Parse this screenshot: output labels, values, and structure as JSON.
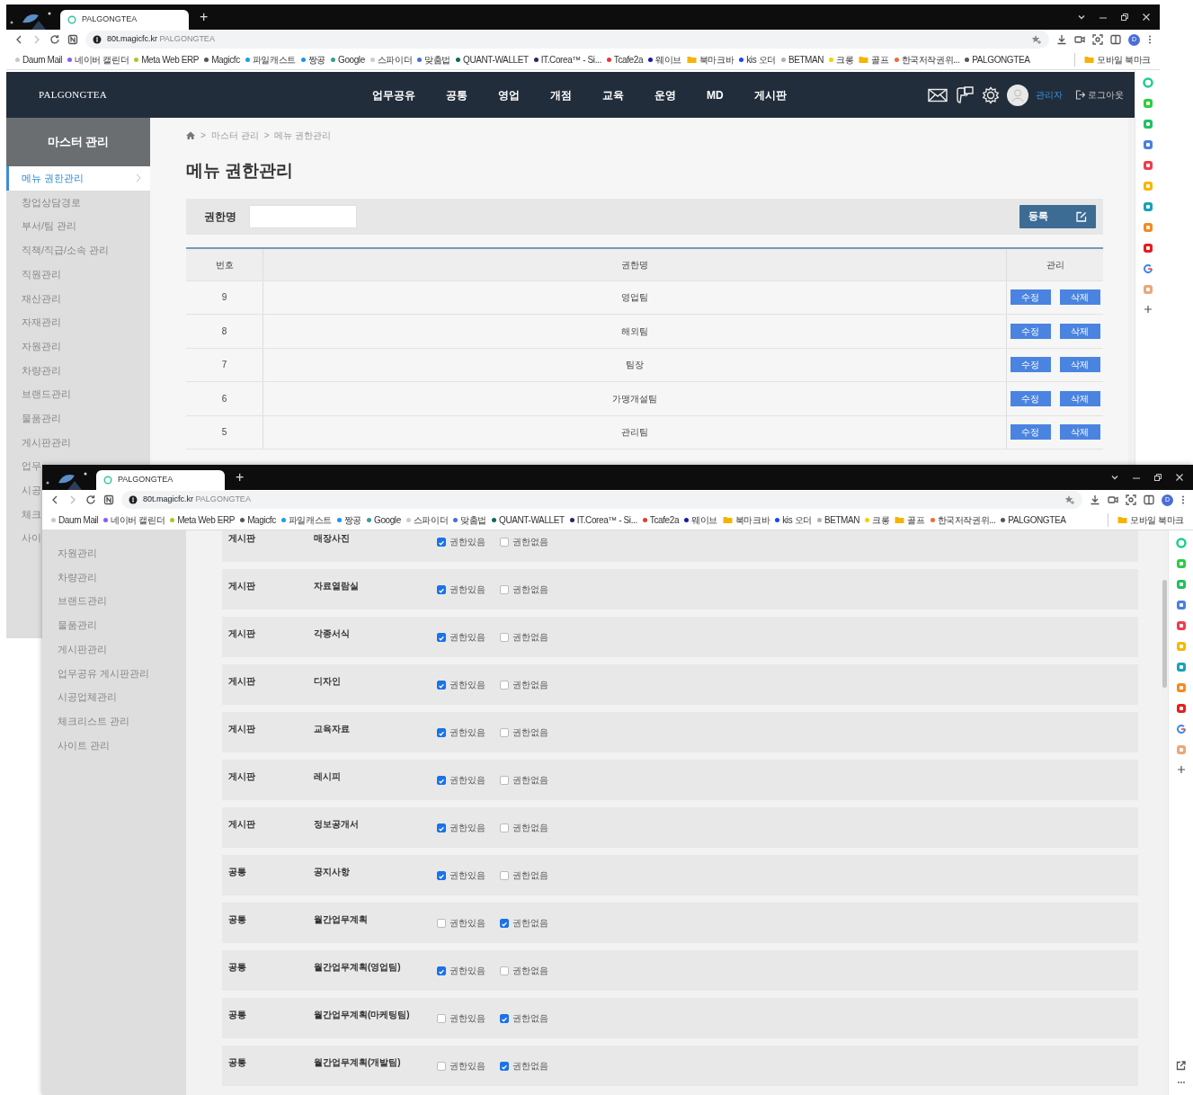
{
  "windows": [
    {
      "browser": {
        "tab_title": "PALGONGTEA",
        "new_tab": "+",
        "url_host": "80t.magicfc.kr",
        "url_title": "PALGONGTEA",
        "profile": "D",
        "mobile_bookmarks": "모바일 북마크",
        "bookmarks": [
          {
            "label": "Daum Mail",
            "kind": "site",
            "color": "#c8c8c8"
          },
          {
            "label": "네이버 캘린더",
            "kind": "site",
            "color": "#8a5cf6"
          },
          {
            "label": "Meta Web ERP",
            "kind": "site",
            "color": "#b5c22a"
          },
          {
            "label": "Magicfc",
            "kind": "site",
            "color": "#555555"
          },
          {
            "label": "파일캐스트",
            "kind": "site",
            "color": "#1ba1e2"
          },
          {
            "label": "짱공",
            "kind": "site",
            "color": "#1e90ff"
          },
          {
            "label": "Google",
            "kind": "site",
            "color": "#3a9e8f"
          },
          {
            "label": "스파이더",
            "kind": "site",
            "color": "#cccccc"
          },
          {
            "label": "맞춤법",
            "kind": "site",
            "color": "#4a6ed8"
          },
          {
            "label": "QUANT-WALLET",
            "kind": "site",
            "color": "#0b6b5a"
          },
          {
            "label": "IT.Corea™ - Si...",
            "kind": "site",
            "color": "#28285e"
          },
          {
            "label": "Tcafe2a",
            "kind": "site",
            "color": "#e53935"
          },
          {
            "label": "웨이브",
            "kind": "site",
            "color": "#1a1aa0"
          },
          {
            "label": "북마크바",
            "kind": "folder"
          },
          {
            "label": "kis 오더",
            "kind": "site",
            "color": "#1546ff"
          },
          {
            "label": "BETMAN",
            "kind": "site",
            "color": "#b0b0b0"
          },
          {
            "label": "크롱",
            "kind": "site",
            "color": "#ffcc00"
          },
          {
            "label": "골프",
            "kind": "folder"
          },
          {
            "label": "한국저작권위...",
            "kind": "site",
            "color": "#f06a3c"
          },
          {
            "label": "PALGONGTEA",
            "kind": "site",
            "color": "#555555"
          }
        ]
      },
      "app": {
        "logo": "PALGONGTEA",
        "nav": [
          "업무공유",
          "공통",
          "영업",
          "개점",
          "교육",
          "운영",
          "MD",
          "게시판"
        ],
        "user": "관리자",
        "logout": "로그아웃",
        "sidebar": {
          "title": "마스터 관리",
          "items": [
            {
              "label": "메뉴 권한관리",
              "selected": true
            },
            {
              "label": "창업상담경로",
              "selected": false
            },
            {
              "label": "부서/팀 관리",
              "selected": false
            },
            {
              "label": "직책/직급/소속 관리",
              "selected": false
            },
            {
              "label": "직원관리",
              "selected": false
            },
            {
              "label": "재산관리",
              "selected": false
            },
            {
              "label": "자재관리",
              "selected": false
            },
            {
              "label": "자원관리",
              "selected": false
            },
            {
              "label": "차량관리",
              "selected": false
            },
            {
              "label": "브랜드관리",
              "selected": false
            },
            {
              "label": "물품관리",
              "selected": false
            },
            {
              "label": "게시판관리",
              "selected": false
            },
            {
              "label": "업무",
              "selected": false
            },
            {
              "label": "시공",
              "selected": false
            },
            {
              "label": "체크",
              "selected": false
            },
            {
              "label": "사이",
              "selected": false
            }
          ]
        },
        "breadcrumb": [
          {
            "separator": ">",
            "label": "마스터 관리"
          },
          {
            "separator": ">",
            "label": "메뉴 권한관리"
          }
        ],
        "page_title": "메뉴 권한관리",
        "search": {
          "label": "권한명"
        },
        "register_button": "등록",
        "table": {
          "columns": [
            "번호",
            "권한명",
            "관리"
          ],
          "rows": [
            {
              "number": "9",
              "name": "영업팀",
              "edit": "수정",
              "delete": "삭제"
            },
            {
              "number": "8",
              "name": "해외팀",
              "edit": "수정",
              "delete": "삭제"
            },
            {
              "number": "7",
              "name": "팀장",
              "edit": "수정",
              "delete": "삭제"
            },
            {
              "number": "6",
              "name": "가맹개설팀",
              "edit": "수정",
              "delete": "삭제"
            },
            {
              "number": "5",
              "name": "관리팀",
              "edit": "수정",
              "delete": "삭제"
            }
          ]
        }
      }
    },
    {
      "browser": {
        "tab_title": "PALGONGTEA",
        "new_tab": "+",
        "url_host": "80t.magicfc.kr",
        "url_title": "PALGONGTEA",
        "profile": "D",
        "mobile_bookmarks": "모바일 북마크",
        "bookmarks": [
          {
            "label": "Daum Mail",
            "kind": "site",
            "color": "#c8c8c8"
          },
          {
            "label": "네이버 캘린더",
            "kind": "site",
            "color": "#8a5cf6"
          },
          {
            "label": "Meta Web ERP",
            "kind": "site",
            "color": "#b5c22a"
          },
          {
            "label": "Magicfc",
            "kind": "site",
            "color": "#555555"
          },
          {
            "label": "파일캐스트",
            "kind": "site",
            "color": "#1ba1e2"
          },
          {
            "label": "짱공",
            "kind": "site",
            "color": "#1e90ff"
          },
          {
            "label": "Google",
            "kind": "site",
            "color": "#3a9e8f"
          },
          {
            "label": "스파이더",
            "kind": "site",
            "color": "#cccccc"
          },
          {
            "label": "맞춤법",
            "kind": "site",
            "color": "#4a6ed8"
          },
          {
            "label": "QUANT-WALLET",
            "kind": "site",
            "color": "#0b6b5a"
          },
          {
            "label": "IT.Corea™ - Si...",
            "kind": "site",
            "color": "#28285e"
          },
          {
            "label": "Tcafe2a",
            "kind": "site",
            "color": "#e53935"
          },
          {
            "label": "웨이브",
            "kind": "site",
            "color": "#1a1aa0"
          },
          {
            "label": "북마크바",
            "kind": "folder"
          },
          {
            "label": "kis 오더",
            "kind": "site",
            "color": "#1546ff"
          },
          {
            "label": "BETMAN",
            "kind": "site",
            "color": "#b0b0b0"
          },
          {
            "label": "크롱",
            "kind": "site",
            "color": "#ffcc00"
          },
          {
            "label": "골프",
            "kind": "folder"
          },
          {
            "label": "한국저작권위...",
            "kind": "site",
            "color": "#f06a3c"
          },
          {
            "label": "PALGONGTEA",
            "kind": "site",
            "color": "#555555"
          }
        ]
      },
      "sidebar_items": [
        "자원관리",
        "차량관리",
        "브랜드관리",
        "물품관리",
        "게시판관리",
        "업무공유 게시판관리",
        "시공업체관리",
        "체크리스트 관리",
        "사이트 관리"
      ],
      "permissions": [
        {
          "category": "게시판",
          "menu": "매장사진",
          "options": [
            {
              "label": "권한있음",
              "checked": true
            },
            {
              "label": "권한없음",
              "checked": false
            }
          ]
        },
        {
          "category": "게시판",
          "menu": "자료열람실",
          "options": [
            {
              "label": "권한있음",
              "checked": true
            },
            {
              "label": "권한없음",
              "checked": false
            }
          ]
        },
        {
          "category": "게시판",
          "menu": "각종서식",
          "options": [
            {
              "label": "권한있음",
              "checked": true
            },
            {
              "label": "권한없음",
              "checked": false
            }
          ]
        },
        {
          "category": "게시판",
          "menu": "디자인",
          "options": [
            {
              "label": "권한있음",
              "checked": true
            },
            {
              "label": "권한없음",
              "checked": false
            }
          ]
        },
        {
          "category": "게시판",
          "menu": "교육자료",
          "options": [
            {
              "label": "권한있음",
              "checked": true
            },
            {
              "label": "권한없음",
              "checked": false
            }
          ]
        },
        {
          "category": "게시판",
          "menu": "레시피",
          "options": [
            {
              "label": "권한있음",
              "checked": true
            },
            {
              "label": "권한없음",
              "checked": false
            }
          ]
        },
        {
          "category": "게시판",
          "menu": "정보공개서",
          "options": [
            {
              "label": "권한있음",
              "checked": true
            },
            {
              "label": "권한없음",
              "checked": false
            }
          ]
        },
        {
          "category": "공통",
          "menu": "공지사항",
          "options": [
            {
              "label": "권한있음",
              "checked": true
            },
            {
              "label": "권한없음",
              "checked": false
            }
          ]
        },
        {
          "category": "공통",
          "menu": "월간업무계획",
          "options": [
            {
              "label": "권한있음",
              "checked": false
            },
            {
              "label": "권한없음",
              "checked": true
            }
          ]
        },
        {
          "category": "공통",
          "menu": "월간업무계획(영업팀)",
          "options": [
            {
              "label": "권한있음",
              "checked": true
            },
            {
              "label": "권한없음",
              "checked": false
            }
          ]
        },
        {
          "category": "공통",
          "menu": "월간업무계획(마케팅팀)",
          "options": [
            {
              "label": "권한있음",
              "checked": false
            },
            {
              "label": "권한없음",
              "checked": true
            }
          ]
        },
        {
          "category": "공통",
          "menu": "월간업무계획(개발팀)",
          "options": [
            {
              "label": "권한있음",
              "checked": false
            },
            {
              "label": "권한없음",
              "checked": true
            }
          ]
        }
      ]
    }
  ]
}
